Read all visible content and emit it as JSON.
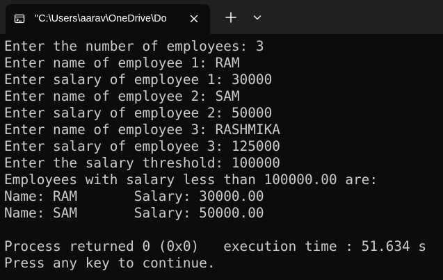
{
  "tab": {
    "title": "\"C:\\Users\\aarav\\OneDrive\\Do",
    "icon": "terminal-icon",
    "close_icon": "close-icon"
  },
  "toolbar": {
    "new_tab_icon": "plus-icon",
    "dropdown_icon": "chevron-down-icon"
  },
  "colors": {
    "background": "#0c0c0c",
    "titlebar": "#202020",
    "text": "#cccccc",
    "tab_text": "#ffffff"
  },
  "console": {
    "lines": [
      "Enter the number of employees: 3",
      "Enter name of employee 1: RAM",
      "Enter salary of employee 1: 30000",
      "Enter name of employee 2: SAM",
      "Enter salary of employee 2: 50000",
      "Enter name of employee 3: RASHMIKA",
      "Enter salary of employee 3: 125000",
      "Enter the salary threshold: 100000",
      "Employees with salary less than 100000.00 are:",
      "Name: RAM       Salary: 30000.00",
      "Name: SAM       Salary: 50000.00",
      "",
      "Process returned 0 (0x0)   execution time : 51.634 s",
      "Press any key to continue."
    ]
  }
}
